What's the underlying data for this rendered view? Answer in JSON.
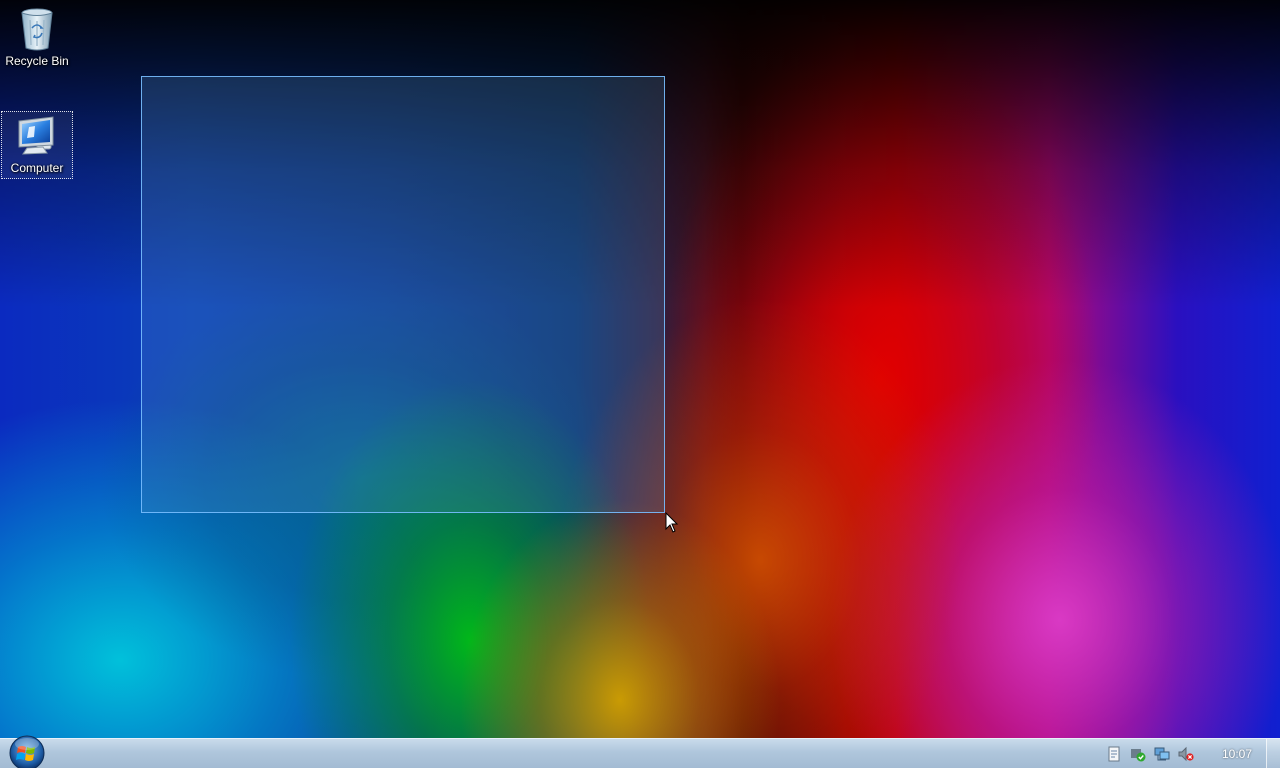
{
  "desktop_icons": [
    {
      "label": "Recycle Bin",
      "icon": "recycle-bin-icon"
    },
    {
      "label": "Computer",
      "icon": "computer-icon",
      "selected": true
    }
  ],
  "taskbar": {
    "start_icon": "windows-orb-icon",
    "tray_icons": [
      "action-center-flag-icon",
      "shield-check-icon",
      "network-icon",
      "speaker-muted-icon"
    ],
    "clock": "10:07"
  },
  "colors": {
    "taskbar_bg": "#b3c9de",
    "selection_border": "#78beff",
    "icon_label": "#ffffff"
  }
}
